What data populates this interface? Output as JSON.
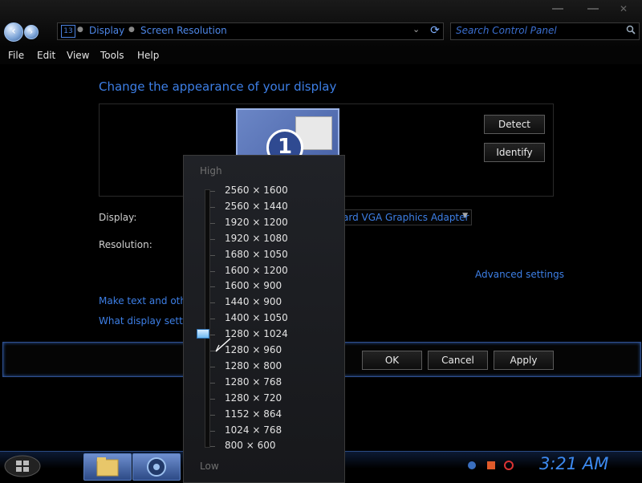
{
  "address_bar": {
    "icon_label": "13",
    "crumbs": [
      "Display",
      "Screen Resolution"
    ]
  },
  "search": {
    "placeholder": "Search Control Panel"
  },
  "menu": [
    "File",
    "Edit",
    "View",
    "Tools",
    "Help"
  ],
  "content": {
    "heading": "Change the appearance of your display",
    "monitor_number": "1",
    "detect_label": "Detect",
    "identify_label": "Identify",
    "display_label": "Display:",
    "display_value": "ard VGA Graphics Adapter",
    "resolution_label": "Resolution:",
    "advanced_link": "Advanced settings",
    "link_text_size": "Make text and other",
    "link_display_settings": "What display setting"
  },
  "buttons": {
    "ok": "OK",
    "cancel": "Cancel",
    "apply": "Apply"
  },
  "resolution_slider": {
    "high_label": "High",
    "low_label": "Low",
    "options": [
      "2560 × 1600",
      "2560 × 1440",
      "1920 × 1200",
      "1920 × 1080",
      "1680 × 1050",
      "1600 × 1200",
      "1600 × 900",
      "1440 × 900",
      "1400 × 1050",
      "1280 × 1024",
      "1280 × 960",
      "1280 × 800",
      "1280 × 768",
      "1280 × 720",
      "1152 × 864",
      "1024 × 768",
      "800 × 600"
    ],
    "selected": "1280 × 1024"
  },
  "taskbar": {
    "clock": "3:21 AM"
  },
  "colors": {
    "accent": "#3d7fe6",
    "background": "#000000"
  }
}
